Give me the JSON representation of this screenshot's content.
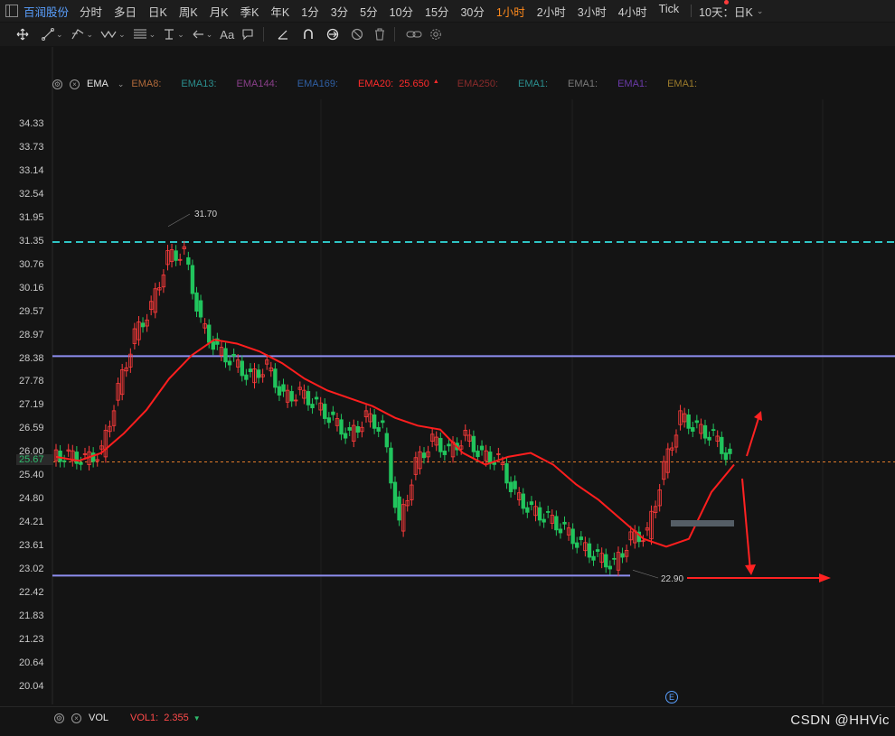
{
  "topbar": {
    "stock_name": "百润股份",
    "timeframes": [
      "分时",
      "多日",
      "日K",
      "周K",
      "月K",
      "季K",
      "年K",
      "1分",
      "3分",
      "5分",
      "10分",
      "15分",
      "30分",
      "1小时",
      "2小时",
      "3小时",
      "4小时",
      "Tick"
    ],
    "active_timeframe": "1小时",
    "range_label": "10天：日K",
    "colors": {
      "active": "#ff8a1c",
      "stock": "#5aa0ff"
    }
  },
  "toolbar": {
    "icons": [
      "crosshair-icon",
      "line-icon",
      "channel-icon",
      "wave-icon",
      "fib-icon",
      "text-anchor-icon",
      "arrow-icon",
      "font-icon",
      "comment-icon",
      "ruler-icon",
      "magnet-icon",
      "sync-icon",
      "hide-icon",
      "trash-icon",
      "link-icon",
      "settings-icon"
    ],
    "font_label": "Aa"
  },
  "ema_legend": {
    "name": "EMA",
    "items": [
      {
        "label": "EMA8:",
        "color": "#b0693a"
      },
      {
        "label": "EMA13:",
        "color": "#2b8f8f"
      },
      {
        "label": "EMA144:",
        "color": "#8a3f8a"
      },
      {
        "label": "EMA169:",
        "color": "#2f5fa3"
      },
      {
        "label": "EMA20:",
        "value": "25.650",
        "color": "#ff2b2b"
      },
      {
        "label": "EMA250:",
        "color": "#8a2b2b"
      },
      {
        "label": "EMA1:",
        "color": "#2b8f8f"
      },
      {
        "label": "EMA1:",
        "color": "#7a7a7a"
      },
      {
        "label": "EMA1:",
        "color": "#6a3aa8"
      },
      {
        "label": "EMA1:",
        "color": "#9a7a2b"
      }
    ]
  },
  "y_axis": [
    "34.33",
    "33.73",
    "33.14",
    "32.54",
    "31.95",
    "31.35",
    "30.76",
    "30.16",
    "29.57",
    "28.97",
    "28.38",
    "27.78",
    "27.19",
    "26.59",
    "26.00",
    "25.40",
    "24.80",
    "24.21",
    "23.61",
    "23.02",
    "22.42",
    "21.83",
    "21.23",
    "20.64",
    "20.04"
  ],
  "current_price": "25.67",
  "high_label": "31.70",
  "low_label": "22.90",
  "volume": {
    "name": "VOL",
    "label": "VOL1:",
    "value": "2.355"
  },
  "e_marker": "E",
  "watermark": "CSDN @HHVic",
  "chart_data": {
    "type": "candlestick",
    "y_range": [
      20.04,
      34.33
    ],
    "horizontal_lines": [
      {
        "price": 31.3,
        "color": "#2ec4c4",
        "style": "dashed"
      },
      {
        "price": 28.38,
        "color": "#8e8ef0",
        "style": "solid"
      },
      {
        "price": 22.76,
        "color": "#8e8ef0",
        "style": "solid"
      },
      {
        "price": 25.67,
        "color": "#e07a2a",
        "style": "dotted"
      }
    ],
    "ema20": [
      25.8,
      25.7,
      25.9,
      26.4,
      27.0,
      27.8,
      28.4,
      28.8,
      28.7,
      28.5,
      28.2,
      27.8,
      27.5,
      27.3,
      27.1,
      26.8,
      26.6,
      26.5,
      25.9,
      25.6,
      25.8,
      25.9,
      25.6,
      25.1,
      24.7,
      24.2,
      23.7,
      23.5,
      23.7,
      24.9,
      25.6
    ],
    "candles_close": [
      25.8,
      25.7,
      25.9,
      27.5,
      28.9,
      29.6,
      30.9,
      31.0,
      29.2,
      28.5,
      28.2,
      27.8,
      28.1,
      27.3,
      27.4,
      27.1,
      26.7,
      26.3,
      26.8,
      26.5,
      24.0,
      25.6,
      26.2,
      25.9,
      26.3,
      25.8,
      25.7,
      24.8,
      24.4,
      24.2,
      23.9,
      23.5,
      23.2,
      23.0,
      23.7,
      23.8,
      25.5,
      26.8,
      26.5,
      26.3,
      25.7
    ]
  }
}
